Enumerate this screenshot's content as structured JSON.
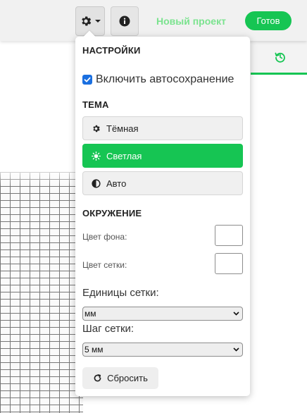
{
  "topbar": {
    "settings_icon": "gear-icon",
    "settings_caret": "caret-down-icon",
    "info_icon": "info-icon",
    "project_name": "Новый проект",
    "done_label": "Готов"
  },
  "right_panel": {
    "tab_icon": "history-icon"
  },
  "settings": {
    "title": "НАСТРОЙКИ",
    "autosave_label": "Включить автосохранение",
    "autosave_checked": true,
    "theme_title": "ТЕМА",
    "themes": [
      {
        "label": "Тёмная",
        "icon": "gear-icon",
        "active": false
      },
      {
        "label": "Светлая",
        "icon": "sun-icon",
        "active": true
      },
      {
        "label": "Авто",
        "icon": "half-circle-icon",
        "active": false
      }
    ],
    "environment_title": "ОКРУЖЕНИЕ",
    "bg_color_label": "Цвет фона:",
    "bg_color_value": "#ffffff",
    "grid_color_label": "Цвет сетки:",
    "grid_color_value": "#ffffff",
    "grid_units_label": "Единицы сетки:",
    "grid_units_value": "мм",
    "grid_step_label": "Шаг сетки:",
    "grid_step_value": "5 мм",
    "reset_label": "Сбросить"
  },
  "colors": {
    "accent": "#16c553",
    "project_name": "#7be38f",
    "checkbox": "#1a6fe0"
  }
}
